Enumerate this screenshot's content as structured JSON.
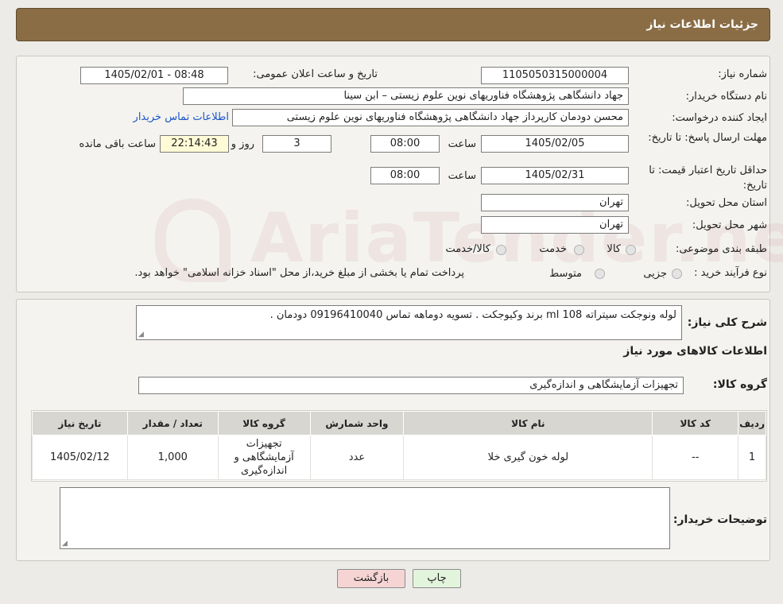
{
  "header": {
    "title": "جزئیات اطلاعات نیاز"
  },
  "form": {
    "need_number_label": "شماره نیاز:",
    "need_number": "1105050315000004",
    "announce_label": "تاریخ و ساعت اعلان عمومی:",
    "announce_value": "1405/02/01 - 08:48",
    "buyer_org_label": "نام دستگاه خریدار:",
    "buyer_org": "جهاد دانشگاهی پژوهشگاه فناوریهای نوین علوم زیستی – ابن سینا",
    "creator_label": "ایجاد کننده درخواست:",
    "creator": "محسن دودمان کارپرداز جهاد دانشگاهی پژوهشگاه فناوریهای نوین علوم زیستی",
    "contact_link": "اطلاعات تماس خریدار",
    "reply_deadline_label": "مهلت ارسال پاسخ: تا تاریخ:",
    "reply_date": "1405/02/05",
    "time_label": "ساعت",
    "reply_time": "08:00",
    "days": "3",
    "days_label": "روز و",
    "remaining": "22:14:43",
    "remaining_label": "ساعت باقی مانده",
    "price_validity_label": "حداقل تاریخ اعتبار قیمت: تا تاریخ:",
    "validity_date": "1405/02/31",
    "validity_time": "08:00",
    "province_label": "استان محل تحویل:",
    "province": "تهران",
    "city_label": "شهر محل تحویل:",
    "city": "تهران",
    "category_label": "طبقه بندی موضوعی:",
    "category_options": [
      "کالا",
      "خدمت",
      "کالا/خدمت"
    ],
    "purchase_label": "نوع فرآیند خرید :",
    "purchase_options": [
      "جزیی",
      "متوسط"
    ],
    "purchase_note": "پرداخت تمام یا بخشی از مبلغ خرید،از محل \"اسناد خزانه اسلامی\" خواهد بود."
  },
  "description": {
    "label": "شرح کلی نیاز:",
    "text": "لوله ونوجکت سیتراته 108 ml برند وکیوجکت .  تسویه دوماهه تماس 09196410040 دودمان ."
  },
  "goods": {
    "section_title": "اطلاعات کالاهای مورد نیاز",
    "group_label": "گروه کالا:",
    "group_value": "تجهیزات آزمایشگاهی و اندازه‌گیری",
    "columns": [
      "ردیف",
      "کد کالا",
      "نام کالا",
      "واحد شمارش",
      "گروه کالا",
      "تعداد / مقدار",
      "تاریخ نیاز"
    ],
    "rows": [
      {
        "index": "1",
        "code": "--",
        "name": "لوله خون گیری خلا",
        "unit": "عدد",
        "group": "تجهیزات آزمایشگاهی و اندازه‌گیری",
        "qty": "1,000",
        "date": "1405/02/12"
      }
    ]
  },
  "buyer_notes": {
    "label": "توضیحات خریدار:",
    "text": ""
  },
  "buttons": {
    "print": "چاپ",
    "back": "بازگشت"
  },
  "watermark": {
    "text": "AriaTender.neT"
  },
  "colors": {
    "header_bg": "#8a6d45",
    "link": "#1a55c9",
    "back_btn": "#f6d4d4",
    "print_btn": "#e3f4dc"
  }
}
